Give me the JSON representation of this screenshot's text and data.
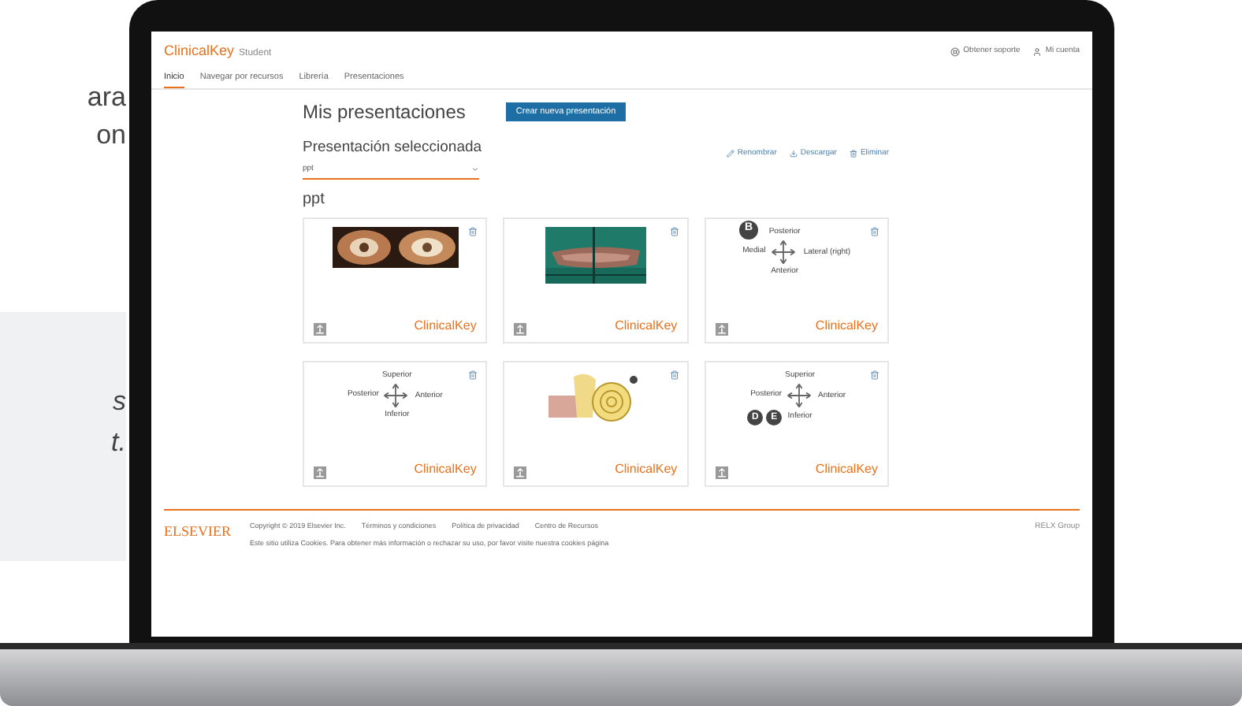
{
  "side_text": {
    "top_lines": [
      "ara",
      "on"
    ],
    "box_lines": [
      "s",
      "t."
    ]
  },
  "header": {
    "logo": "ClinicalKey",
    "logo_sub": "Student",
    "links": [
      {
        "kind": "support",
        "label": "Obtener soporte"
      },
      {
        "kind": "account",
        "label": "Mi cuenta"
      }
    ]
  },
  "nav": [
    {
      "label": "Inicio",
      "selected": true
    },
    {
      "label": "Navegar por recursos",
      "selected": false
    },
    {
      "label": "Librería",
      "selected": false
    },
    {
      "label": "Presentaciones",
      "selected": false
    }
  ],
  "title": "Mis presentaciones",
  "create_button": "Crear nueva presentación",
  "selected_label": "Presentación seleccionada",
  "select_value": "ppt",
  "actions": [
    {
      "kind": "edit",
      "label": "Renombrar"
    },
    {
      "kind": "download",
      "label": "Descargar"
    },
    {
      "kind": "delete",
      "label": "Eliminar"
    }
  ],
  "section": "ppt",
  "cards": [
    {
      "kind": "eyes",
      "brand": "ClinicalKey"
    },
    {
      "kind": "tissue",
      "brand": "ClinicalKey"
    },
    {
      "kind": "diagram",
      "badges": [
        "B"
      ],
      "top": "Posterior",
      "left": "Medial",
      "right": "Lateral (right)",
      "bottom": "Anterior",
      "brand": "ClinicalKey"
    },
    {
      "kind": "diagram",
      "top": "Superior",
      "left": "Posterior",
      "right": "Anterior",
      "bottom": "Inferior",
      "brand": "ClinicalKey"
    },
    {
      "kind": "ear",
      "brand": "ClinicalKey"
    },
    {
      "kind": "diagram",
      "badges": [
        "D",
        "E"
      ],
      "top": "Superior",
      "left": "Posterior",
      "right": "Anterior",
      "bottom": "Inferior",
      "brand": "ClinicalKey"
    }
  ],
  "footer": {
    "brand": "ELSEVIER",
    "links": [
      "Copyright © 2019 Elsevier Inc.",
      "Términos y condiciones",
      "Política de privacidad",
      "Centro de Recursos"
    ],
    "cookie_note": "Este sitio utiliza Cookies. Para obtener más información o rechazar su uso, por favor visite nuestra cookies página",
    "group": "RELX Group"
  }
}
